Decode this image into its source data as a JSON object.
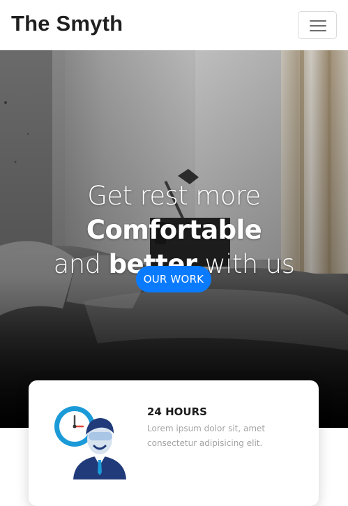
{
  "navbar": {
    "brand": "The Smyth"
  },
  "hero": {
    "title_part1": "Get rest more ",
    "title_bold1": "Comfortable",
    "title_part2": "and ",
    "title_bold2": "better",
    "title_part3": " with us",
    "cta_label": "OUR WORK"
  },
  "feature": {
    "title": "24 HOURS",
    "text": "Lorem ipsum dolor sit, amet consectetur adipisicing elit."
  },
  "colors": {
    "accent": "#0a7bff",
    "brand_text": "#1f1f1f"
  },
  "icons": {
    "menu": "hamburger-menu-icon",
    "feature": "clock-support-person-icon"
  }
}
